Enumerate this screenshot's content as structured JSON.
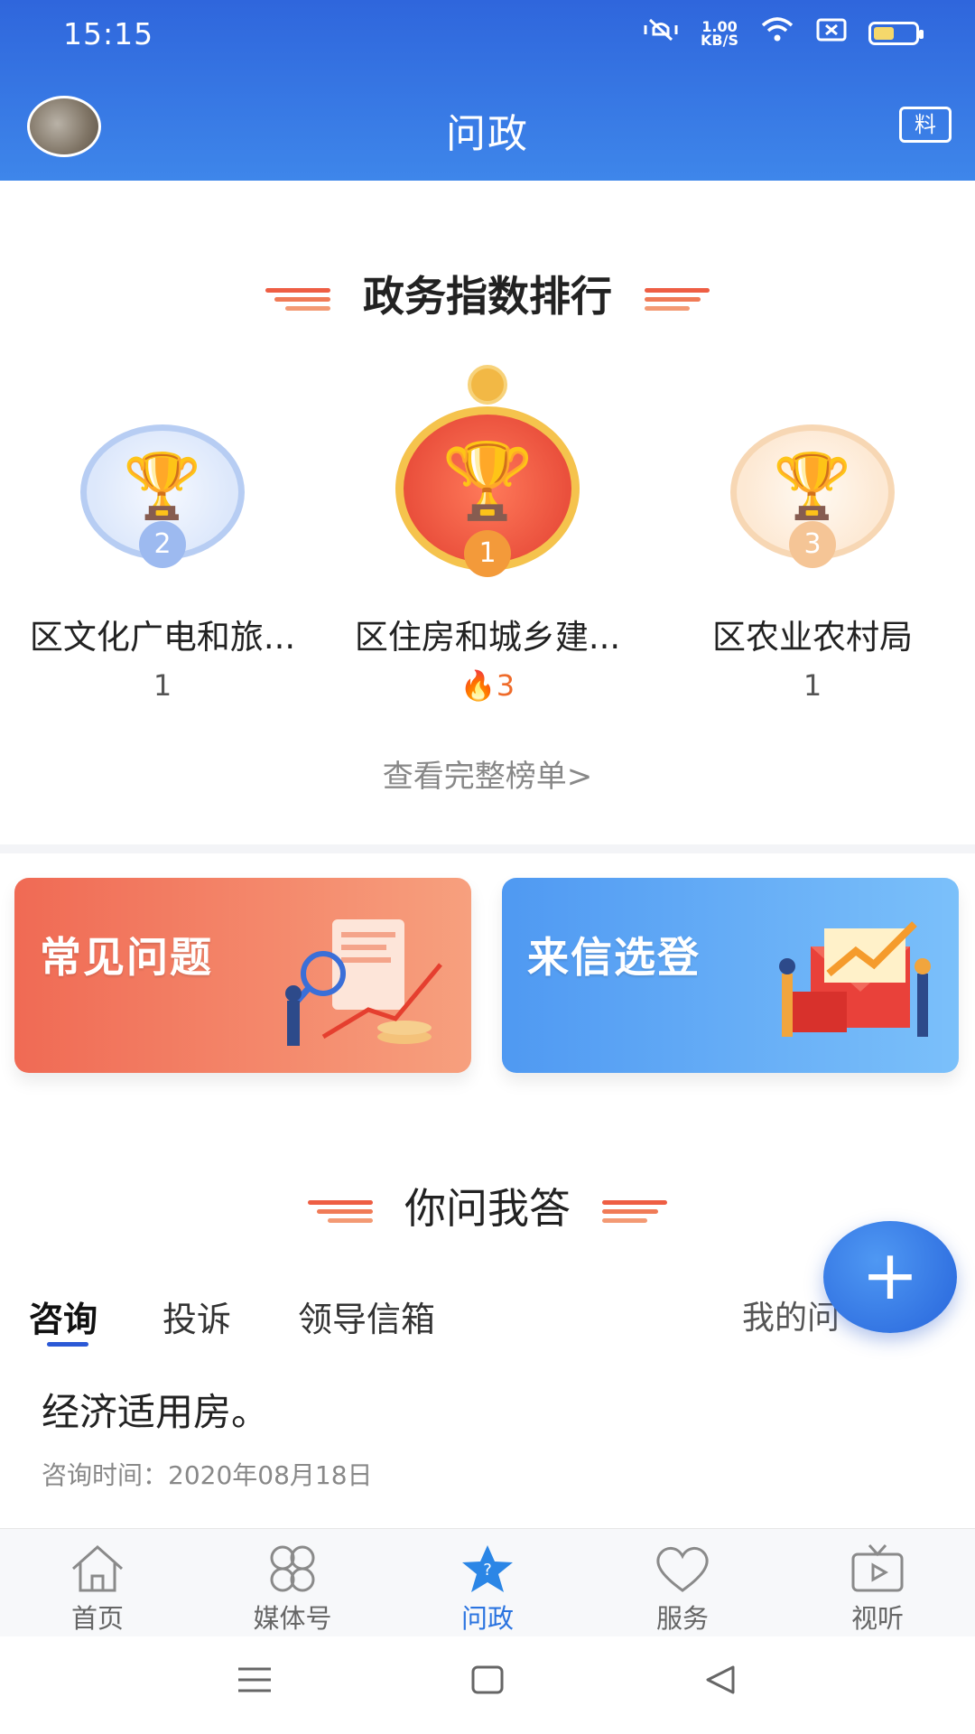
{
  "status_bar": {
    "time": "15:15",
    "net_speed_value": "1.00",
    "net_speed_unit": "KB/S"
  },
  "header": {
    "title": "问政",
    "report_label": "料"
  },
  "ranking": {
    "title": "政务指数排行",
    "items": [
      {
        "rank": "2",
        "name": "区文化广电和旅...",
        "score": "1"
      },
      {
        "rank": "1",
        "name": "区住房和城乡建...",
        "score": "3"
      },
      {
        "rank": "3",
        "name": "区农业农村局",
        "score": "1"
      }
    ],
    "view_full": "查看完整榜单>"
  },
  "cards": {
    "faq": "常见问题",
    "letters": "来信选登"
  },
  "qa": {
    "title": "你问我答",
    "tabs": [
      "咨询",
      "投诉",
      "领导信箱"
    ],
    "my_questions": "我的问",
    "items": [
      {
        "title": "经济适用房。",
        "meta": "咨询时间：2020年08月18日"
      }
    ]
  },
  "bottom_nav": [
    {
      "label": "首页",
      "icon": "home-icon"
    },
    {
      "label": "媒体号",
      "icon": "media-grid-icon"
    },
    {
      "label": "问政",
      "icon": "question-star-icon"
    },
    {
      "label": "服务",
      "icon": "heart-icon"
    },
    {
      "label": "视听",
      "icon": "tv-play-icon"
    }
  ],
  "colors": {
    "header": "#2f66dc",
    "accent": "#2b74e0",
    "faq_card": "#f07356",
    "letters_card": "#4f99f2",
    "decoration": "#ee5e44"
  }
}
